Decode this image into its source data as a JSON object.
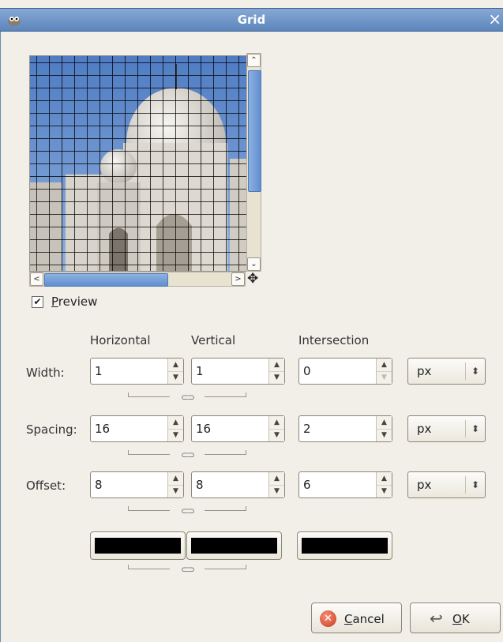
{
  "window": {
    "title": "Grid",
    "close_glyph": "×"
  },
  "preview": {
    "checkbox_checked": true,
    "check_glyph": "✔",
    "label_first": "P",
    "label_rest": "review"
  },
  "scroll": {
    "up_glyph": "⌃",
    "down_glyph": "⌄",
    "left_glyph": "<",
    "right_glyph": ">",
    "nav_glyph": "✥"
  },
  "columns": {
    "horizontal": "Horizontal",
    "vertical": "Vertical",
    "intersection": "Intersection"
  },
  "rows": [
    {
      "label": "Width:",
      "horizontal": "1",
      "vertical": "1",
      "intersection": "0",
      "unit": "px"
    },
    {
      "label": "Spacing:",
      "horizontal": "16",
      "vertical": "16",
      "intersection": "2",
      "unit": "px"
    },
    {
      "label": "Offset:",
      "horizontal": "8",
      "vertical": "8",
      "intersection": "6",
      "unit": "px"
    }
  ],
  "colors": {
    "horizontal": "#000000",
    "vertical": "#000000",
    "intersection": "#000000"
  },
  "buttons": {
    "cancel_first": "C",
    "cancel_rest": "ancel",
    "ok_first": "O",
    "ok_rest": "K"
  },
  "icons": {
    "app": "gimp-icon",
    "close": "close-icon",
    "chain": "chain-link-icon",
    "cancel": "cancel-icon",
    "ok": "ok-icon",
    "nav": "navigate-icon"
  }
}
